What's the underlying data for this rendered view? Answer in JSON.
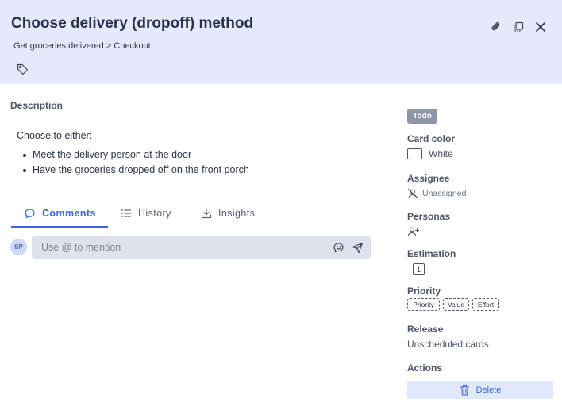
{
  "header": {
    "title": "Choose delivery (dropoff) method",
    "breadcrumb": "Get groceries delivered > Checkout"
  },
  "description": {
    "label": "Description",
    "intro": "Choose to either:",
    "bullets": [
      "Meet the delivery person at the door",
      "Have the groceries dropped off on the front porch"
    ]
  },
  "tabs": [
    {
      "label": "Comments",
      "icon": "comment-icon",
      "active": true
    },
    {
      "label": "History",
      "icon": "list-icon",
      "active": false
    },
    {
      "label": "Insights",
      "icon": "download-icon",
      "active": false
    }
  ],
  "comment": {
    "avatar_initials": "SP",
    "placeholder": "Use @ to mention"
  },
  "sidebar": {
    "status": "Todo",
    "card_color": {
      "label": "Card color",
      "value": "White"
    },
    "assignee": {
      "label": "Assignee",
      "value": "Unassigned"
    },
    "personas": {
      "label": "Personas"
    },
    "estimation": {
      "label": "Estimation",
      "value": "1"
    },
    "priority": {
      "label": "Priority",
      "chips": [
        "Priority",
        "Value",
        "Effort"
      ]
    },
    "release": {
      "label": "Release",
      "value": "Unscheduled cards"
    },
    "actions": {
      "label": "Actions",
      "delete_label": "Delete"
    }
  },
  "colors": {
    "header_bg": "#e6e9fb",
    "accent": "#3a66d8",
    "status_badge": "#8e96a6"
  }
}
